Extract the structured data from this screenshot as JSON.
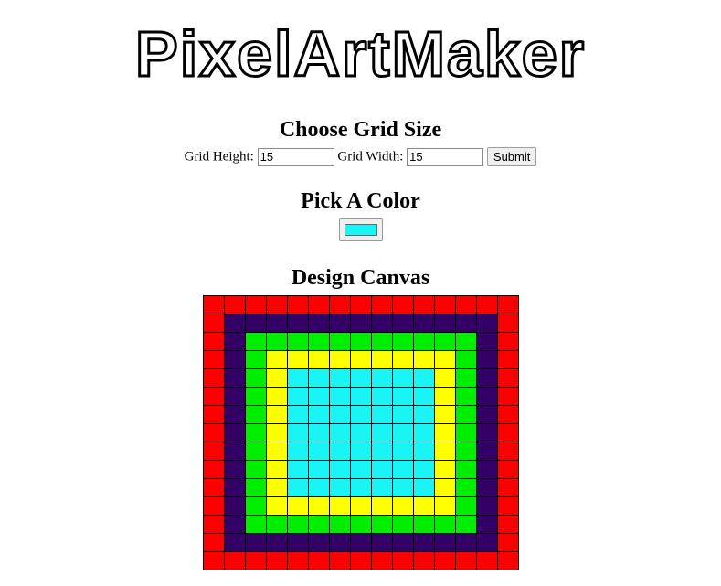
{
  "header": {
    "logo_text": "PixelArtMaker"
  },
  "grid_form": {
    "title": "Choose Grid Size",
    "height_label": "Grid Height:",
    "height_value": "15",
    "width_label": "Grid Width:",
    "width_value": "15",
    "submit_label": "Submit"
  },
  "color_picker": {
    "title": "Pick A Color",
    "value": "#19f5f5"
  },
  "canvas": {
    "title": "Design Canvas",
    "rows": 15,
    "cols": 15,
    "palette": [
      "#ff0000",
      "#330066",
      "#00ee00",
      "#ffff00",
      "#19f5f5"
    ],
    "ring_color_index": [
      0,
      1,
      2,
      3,
      4,
      4,
      4,
      4
    ]
  }
}
